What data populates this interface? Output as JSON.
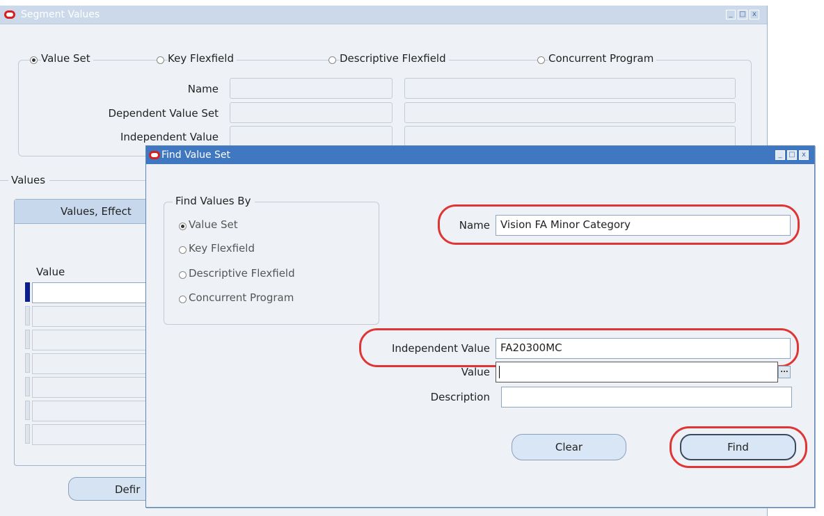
{
  "segment_window": {
    "title": "Segment Values",
    "options": [
      "Value Set",
      "Key Flexfield",
      "Descriptive Flexfield",
      "Concurrent Program"
    ],
    "selected_option": "Value Set",
    "labels": {
      "name": "Name",
      "dependent_value_set": "Dependent Value Set",
      "independent_value": "Independent Value"
    },
    "values_section": "Values",
    "tab_label": "Values, Effect",
    "column_value": "Value",
    "define_button": "Defir"
  },
  "find_window": {
    "title": "Find Value Set",
    "group_title": "Find Values By",
    "options": [
      "Value Set",
      "Key Flexfield",
      "Descriptive Flexfield",
      "Concurrent Program"
    ],
    "selected_option": "Value Set",
    "name_label": "Name",
    "name_value": "Vision FA Minor Category",
    "independent_label": "Independent Value",
    "independent_value": "FA20300MC",
    "value_label": "Value",
    "value_value": "",
    "description_label": "Description",
    "description_value": "",
    "lov_icon": "...",
    "clear_button": "Clear",
    "find_button": "Find"
  },
  "window_controls": {
    "minimize": "minimize-icon",
    "maximize": "maximize-icon",
    "close": "close-icon",
    "close_glyph": "x"
  },
  "colors": {
    "highlight": "#e03535",
    "title_active": "#3f78c0",
    "title_inactive": "#cbd9eb"
  }
}
